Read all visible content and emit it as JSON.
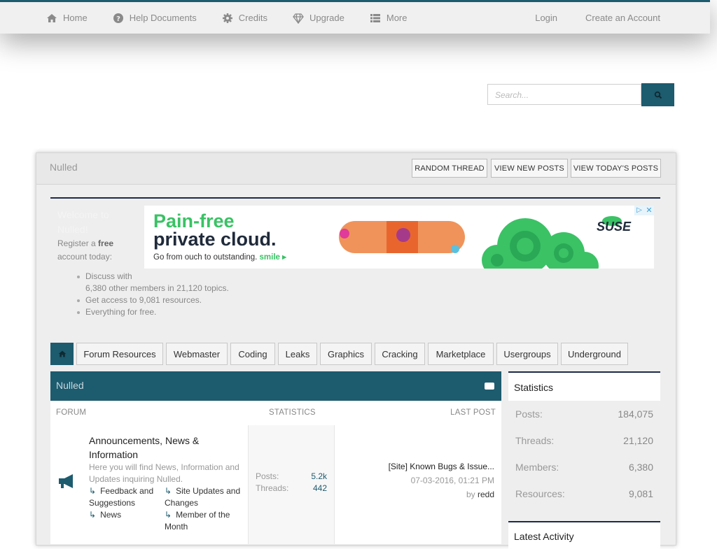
{
  "nav": {
    "left": [
      {
        "label": "Home",
        "icon": "home-icon"
      },
      {
        "label": "Help Documents",
        "icon": "question-icon"
      },
      {
        "label": "Credits",
        "icon": "gear-icon"
      },
      {
        "label": "Upgrade",
        "icon": "diamond-icon"
      },
      {
        "label": "More",
        "icon": "list-icon"
      }
    ],
    "right": [
      {
        "label": "Login"
      },
      {
        "label": "Create an Account"
      }
    ]
  },
  "search": {
    "placeholder": "Search..."
  },
  "panel": {
    "title": "Nulled",
    "buttons": [
      "RANDOM THREAD",
      "VIEW NEW POSTS",
      "VIEW TODAY'S POSTS"
    ]
  },
  "welcome": {
    "title_line1": "Welcome to",
    "title_line2": "Nulled!",
    "register_prefix": "Register a",
    "register_bold": "free",
    "register_suffix": "account today:",
    "bullets": [
      "Discuss with",
      "6,380 other members in 21,120 topics.",
      "Get access to 9,081 resources.",
      "Everything for free."
    ]
  },
  "ad": {
    "headline1": "Pain-free",
    "headline2": "private cloud.",
    "sub": "Go from ouch to outstanding.",
    "cta": "smile",
    "brand": "SUSE"
  },
  "tabs": [
    "Forum Resources",
    "Webmaster",
    "Coding",
    "Leaks",
    "Graphics",
    "Cracking",
    "Marketplace",
    "Usergroups",
    "Underground"
  ],
  "forum": {
    "section_title": "Nulled",
    "columns": {
      "forum": "FORUM",
      "statistics": "STATISTICS",
      "last_post": "LAST POST"
    },
    "rows": [
      {
        "title": "Announcements, News & Information",
        "description": "Here you will find News, Information and Updates inquiring Nulled.",
        "subforums": [
          "Feedback and Suggestions",
          "Site Updates and Changes",
          "News",
          "Member of the Month"
        ],
        "posts_label": "Posts:",
        "posts": "5.2k",
        "threads_label": "Threads:",
        "threads": "442",
        "last_post_title": "[Site] Known Bugs & Issue...",
        "last_post_date": "07-03-2016, 01:21 PM",
        "last_post_by": "by",
        "last_post_user": "redd"
      }
    ]
  },
  "statistics": {
    "title": "Statistics",
    "rows": [
      {
        "label": "Posts:",
        "value": "184,075"
      },
      {
        "label": "Threads:",
        "value": "21,120"
      },
      {
        "label": "Members:",
        "value": "6,380"
      },
      {
        "label": "Resources:",
        "value": "9,081"
      }
    ]
  },
  "latest_activity": {
    "title": "Latest Activity"
  },
  "colors": {
    "accent": "#1d5b6e",
    "dark_rule": "#1e2a4a",
    "ad_green": "#3ac265"
  }
}
